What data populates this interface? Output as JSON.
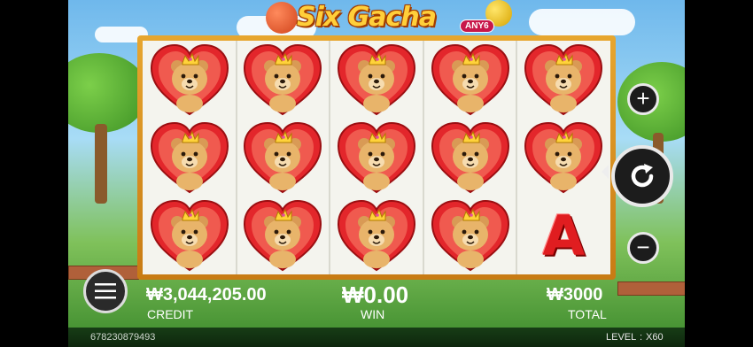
{
  "game": {
    "title": "Six Gacha",
    "badge": "ANY6"
  },
  "reels": [
    [
      "heart-bear",
      "heart-bear",
      "heart-bear"
    ],
    [
      "heart-bear",
      "heart-bear",
      "heart-bear"
    ],
    [
      "heart-bear",
      "heart-bear",
      "heart-bear"
    ],
    [
      "heart-bear",
      "heart-bear",
      "heart-bear"
    ],
    [
      "heart-bear",
      "heart-bear",
      "A"
    ]
  ],
  "symbols": {
    "letter_a": "A"
  },
  "controls": {
    "menu_icon": "hamburger-icon",
    "plus_icon": "plus-icon",
    "spin_icon": "refresh-icon",
    "minus_icon": "minus-icon"
  },
  "info": {
    "credit_value": "₩3,044,205.00",
    "credit_label": "CREDIT",
    "win_value": "₩0.00",
    "win_label": "WIN",
    "total_value": "₩3000",
    "total_label": "TOTAL"
  },
  "footer": {
    "ticket_id": "678230879493",
    "level_label": "LEVEL",
    "level_value": "X60"
  },
  "colors": {
    "frame": "#e7a62f",
    "heart": "#e3262b",
    "bear": "#e8b46a",
    "letter": "#e01d20"
  }
}
